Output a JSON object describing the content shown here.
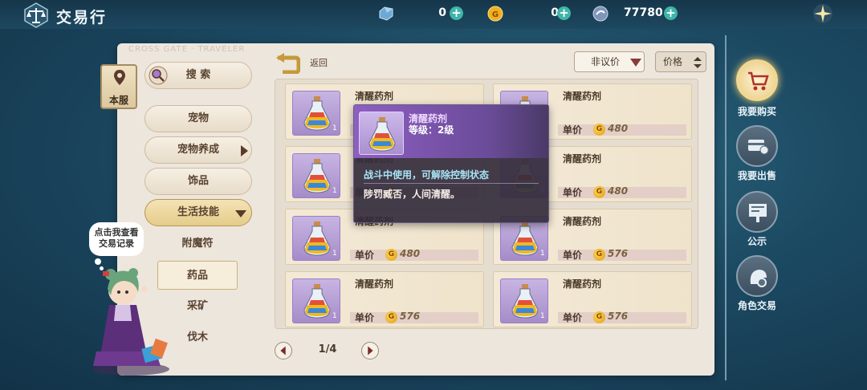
{
  "header": {
    "title": "交易行",
    "currencies": [
      {
        "icon": "crystal-currency-icon",
        "value": "0"
      },
      {
        "icon": "gold-coin-icon",
        "value": "0"
      },
      {
        "icon": "silver-orb-currency-icon",
        "value": "77780"
      }
    ]
  },
  "panel": {
    "watermark": "CROSS GATE · TRAVELER"
  },
  "server_badge": "本服",
  "sidebar": {
    "search": "搜 索",
    "items": [
      {
        "label": "宠物"
      },
      {
        "label": "宠物养成"
      },
      {
        "label": "饰品"
      },
      {
        "label": "生活技能"
      }
    ],
    "subitems": [
      {
        "label": "附魔符"
      },
      {
        "label": "药品"
      },
      {
        "label": "采矿"
      },
      {
        "label": "伐木"
      }
    ]
  },
  "npc_bubble": [
    "点击我查看",
    "交易记录"
  ],
  "toolbar": {
    "back_label": "返回",
    "filter_label": "非议价",
    "sort_label": "价格"
  },
  "listings": [
    {
      "name": "清醒药剂",
      "count": "1",
      "price_label": "单价",
      "price": ""
    },
    {
      "name": "清醒药剂",
      "count": "1",
      "price_label": "单价",
      "price": "480"
    },
    {
      "name": "清醒药剂",
      "count": "1",
      "price_label": "单价",
      "price": ""
    },
    {
      "name": "清醒药剂",
      "count": "1",
      "price_label": "单价",
      "price": "480"
    },
    {
      "name": "清醒药剂",
      "count": "1",
      "price_label": "单价",
      "price": "480"
    },
    {
      "name": "清醒药剂",
      "count": "1",
      "price_label": "单价",
      "price": "576"
    },
    {
      "name": "清醒药剂",
      "count": "1",
      "price_label": "单价",
      "price": "576"
    },
    {
      "name": "清醒药剂",
      "count": "1",
      "price_label": "单价",
      "price": "576"
    }
  ],
  "pagination": {
    "text": "1/4"
  },
  "tooltip": {
    "name": "清醒药剂",
    "level": "等级：2级",
    "desc1": "战斗中使用，可解除控制状态",
    "desc2": "陟罚臧否，人间清醒。"
  },
  "right_nav": [
    {
      "label": "我要购买",
      "icon": "shopping-cart-icon"
    },
    {
      "label": "我要出售",
      "icon": "sell-card-icon"
    },
    {
      "label": "公示",
      "icon": "notice-board-icon"
    },
    {
      "label": "角色交易",
      "icon": "character-trade-icon"
    }
  ]
}
